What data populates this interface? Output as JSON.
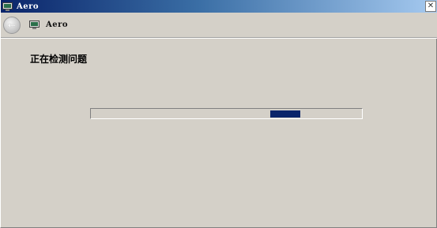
{
  "window": {
    "title": "Aero",
    "close_label": "✕"
  },
  "nav": {
    "back_glyph": "←",
    "title": "Aero",
    "icon": "monitor-icon"
  },
  "content": {
    "heading": "正在检测问题"
  },
  "progress": {
    "style": "marquee",
    "fill_color": "#0a246a"
  },
  "colors": {
    "titlebar_start": "#0a246a",
    "titlebar_end": "#a6caf0",
    "face": "#d4d0c8"
  }
}
